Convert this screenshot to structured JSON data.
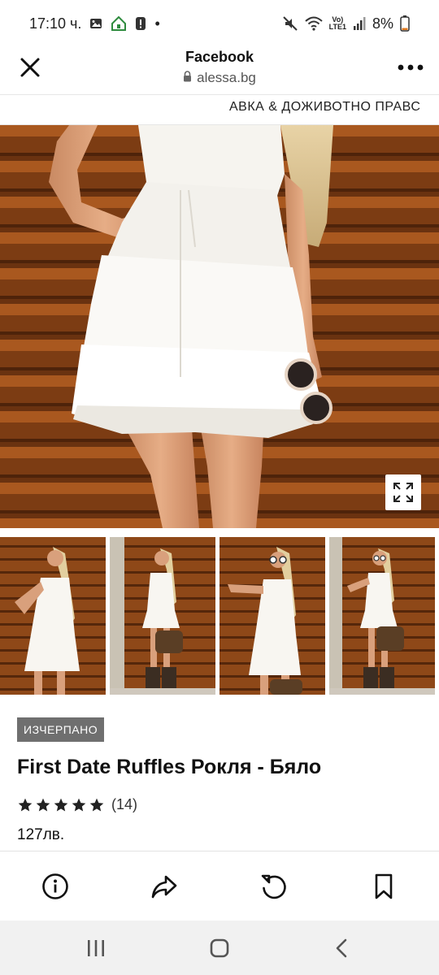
{
  "status_bar": {
    "time": "17:10 ч.",
    "dot": "•",
    "battery_text": "8%",
    "network_label_top": "Vo)",
    "network_label_bottom": "LTE1"
  },
  "browser": {
    "title": "Facebook",
    "url": "alessa.bg"
  },
  "marquee": {
    "text": "АВКА & ДОЖИВОТНО ПРАВС"
  },
  "product": {
    "badge": "ИЗЧЕРПАНО",
    "title": "First Date Ruffles Рокля - Бяло",
    "rating_stars": 5,
    "review_count": "(14)",
    "price": "127лв."
  },
  "thumbnails": [
    "thumb-1",
    "thumb-2",
    "thumb-3",
    "thumb-4"
  ],
  "colors": {
    "badge_bg": "#6f6f6f",
    "wood": "#8a4418",
    "wood_dark": "#5a2a0e",
    "nav_bg": "#f1f1f1"
  },
  "icons": {
    "close": "close-icon",
    "more": "more-options-icon",
    "lock": "lock-icon",
    "expand": "expand-icon",
    "info": "info-icon",
    "share": "share-icon",
    "reload": "reload-icon",
    "bookmark": "bookmark-icon",
    "recents": "recents-icon",
    "home": "home-icon",
    "back": "back-icon"
  }
}
